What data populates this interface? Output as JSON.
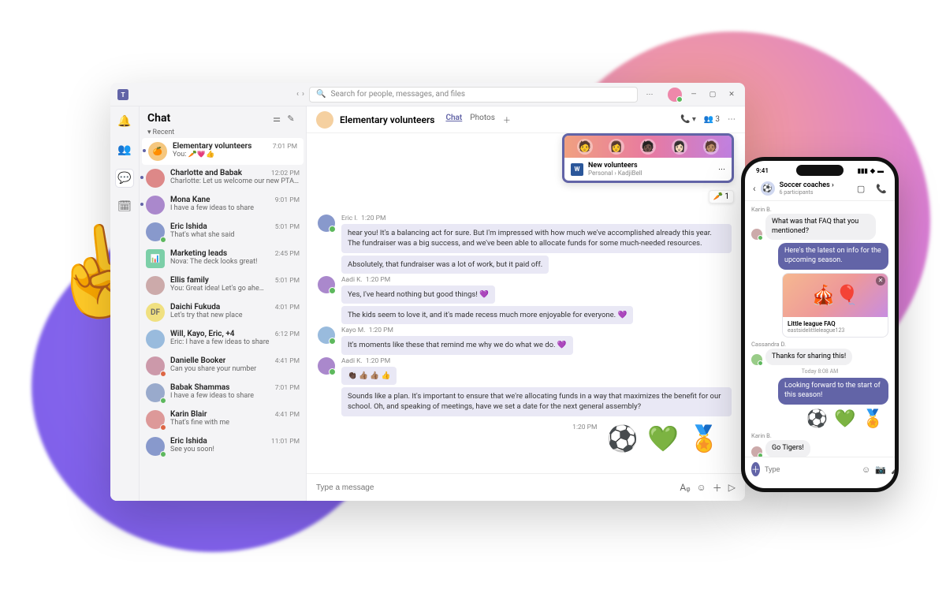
{
  "titlebar": {
    "search_placeholder": "Search for people, messages, and files",
    "more": "⋯",
    "min": "—",
    "max": "▢",
    "close": "✕"
  },
  "rail": {
    "items": [
      "🔔",
      "👥",
      "💬",
      "🗓"
    ]
  },
  "chatlist": {
    "title": "Chat",
    "section": "Recent",
    "items": [
      {
        "name": "Elementary volunteers",
        "preview": "You: 🥕💗👍",
        "time": "7:01 PM",
        "active": true,
        "unread": true,
        "avatar": "🍊",
        "color": "#f5c77e"
      },
      {
        "name": "Charlotte and Babak",
        "preview": "Charlotte: Let us welcome our new PTA volu…",
        "time": "12:02 PM",
        "unread": true,
        "avatar": "",
        "color": "#d88"
      },
      {
        "name": "Mona Kane",
        "preview": "I have a few ideas to share",
        "time": "9:01 PM",
        "unread": true,
        "avatar": "",
        "color": "#a8c"
      },
      {
        "name": "Eric Ishida",
        "preview": "That's what she said",
        "time": "5:01 PM",
        "avatar": "",
        "color": "#89c",
        "presence": "online"
      },
      {
        "name": "Marketing leads",
        "preview": "Nova: The deck looks great!",
        "time": "2:45 PM",
        "avatar": "📊",
        "color": "#7ccfa8",
        "square": true
      },
      {
        "name": "Ellis family",
        "preview": "You: Great idea! Let's go ahe…",
        "time": "5:01 PM",
        "avatar": "",
        "color": "#caa"
      },
      {
        "name": "Daichi Fukuda",
        "preview": "Let's try that new place",
        "time": "4:01 PM",
        "avatar": "DF",
        "color": "#f0e080",
        "text": true
      },
      {
        "name": "Will, Kayo, Eric, +4",
        "preview": "Eric: I have a few ideas to share",
        "time": "6:12 PM",
        "avatar": "",
        "color": "#9bd"
      },
      {
        "name": "Danielle Booker",
        "preview": "Can you share your number",
        "time": "4:41 PM",
        "avatar": "",
        "color": "#c9a",
        "presence": "busy"
      },
      {
        "name": "Babak Shammas",
        "preview": "I have a few ideas to share",
        "time": "7:01 PM",
        "avatar": "",
        "color": "#9ac",
        "presence": "online"
      },
      {
        "name": "Karin Blair",
        "preview": "That's fine with me",
        "time": "4:41 PM",
        "avatar": "",
        "color": "#d99",
        "presence": "busy"
      },
      {
        "name": "Eric Ishida",
        "preview": "See you soon!",
        "time": "11:01 PM",
        "avatar": "",
        "color": "#89c",
        "presence": "online"
      }
    ]
  },
  "main": {
    "title": "Elementary volunteers",
    "tabs": [
      "Chat",
      "Photos"
    ],
    "people_count": "3",
    "shared": {
      "file": "New volunteers",
      "loc": "Personal › KadjiBell"
    },
    "reaction": {
      "emoji": "🥕",
      "count": "1"
    },
    "threads": [
      {
        "author": "Eric I.",
        "time": "1:20 PM",
        "color": "#89c",
        "bubbles": [
          "hear you! It's a balancing act for sure. But I'm impressed with how much we've accomplished already this year. The fundraiser was a big success, and we've been able to allocate funds for some much-needed resources.",
          "Absolutely, that fundraiser was a lot of work, but it paid off."
        ]
      },
      {
        "author": "Aadi K.",
        "time": "1:20 PM",
        "color": "#a8c",
        "bubbles": [
          "Yes, I've heard nothing but good things! 💜",
          "The kids seem to love it, and it's made recess much more enjoyable for everyone. 💜"
        ]
      },
      {
        "author": "Kayo M.",
        "time": "1:20 PM",
        "color": "#9bd",
        "bubbles": [
          "It's moments like these that remind me why we do what we do. 💜"
        ]
      },
      {
        "author": "Aadi K.",
        "time": "1:20 PM",
        "color": "#a8c",
        "bubbles": [
          "👏🏿 👍🏽 👍🏽 👍",
          "Sounds like a plan. It's important to ensure that we're allocating funds in a way that maximizes the benefit for our school. Oh, and speaking of meetings, have we set a date for the next general assembly?"
        ]
      }
    ],
    "emoji_time": "1:20 PM",
    "big_emojis": [
      "⚽",
      "💚",
      "🏅"
    ],
    "composer_placeholder": "Type a message"
  },
  "phone": {
    "time": "9:41",
    "title": "Soccer coaches ›",
    "subtitle": "6 participants",
    "msgs": {
      "karin1_label": "Karin B.",
      "karin1": "What was that FAQ that you mentioned?",
      "out1": "Here's the latest on info for the upcoming season.",
      "card_title": "Little league FAQ",
      "card_sub": "eastsidelittleleague123",
      "cass_label": "Cassandra D.",
      "cass": "Thanks for sharing this!",
      "timestamp": "Today 8:08 AM",
      "out2": "Looking forward to the start of this season!",
      "karin2_label": "Karin B.",
      "karin2": "Go Tigers!"
    },
    "emojis": [
      "⚽",
      "💚",
      "🏅"
    ],
    "composer_placeholder": "Type"
  }
}
